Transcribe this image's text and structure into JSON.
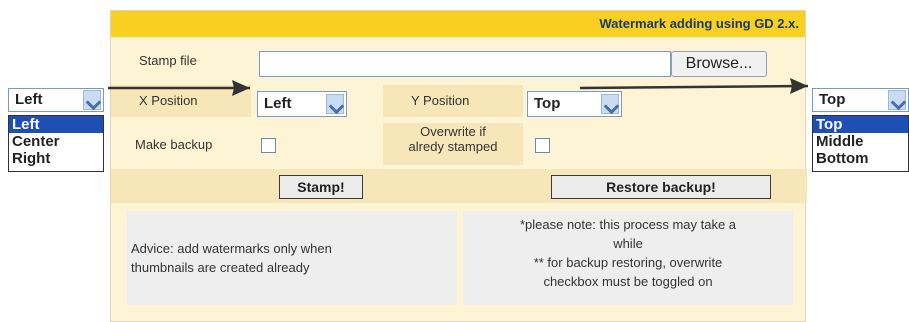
{
  "window": {
    "title": "Watermark adding using GD 2.x."
  },
  "form": {
    "stamp_file_label": "Stamp file",
    "stamp_file_value": "",
    "browse_label": "Browse...",
    "x_position_label": "X Position",
    "x_position_value": "Left",
    "y_position_label": "Y Position",
    "y_position_value": "Top",
    "make_backup_label": "Make backup",
    "overwrite_label_line1": "Overwrite if",
    "overwrite_label_line2": "alredy stamped",
    "stamp_button": "Stamp!",
    "restore_button": "Restore backup!"
  },
  "notes": {
    "advice_line1": "Advice: add watermarks only when",
    "advice_line2": "thumbnails are created already",
    "note_line1": "*please note: this process may take a",
    "note_line2": "while",
    "note_line3": "** for backup restoring, overwrite",
    "note_line4": "checkbox must be toggled on"
  },
  "left_dropdown": {
    "selected": "Left",
    "options": [
      "Left",
      "Center",
      "Right"
    ]
  },
  "right_dropdown": {
    "selected": "Top",
    "options": [
      "Top",
      "Middle",
      "Bottom"
    ]
  },
  "colors": {
    "header": "#fad020",
    "panel": "#fdf3d5",
    "cell": "#f7e7b8",
    "title_text": "#1a3a6e",
    "selection": "#1d4fb4"
  }
}
